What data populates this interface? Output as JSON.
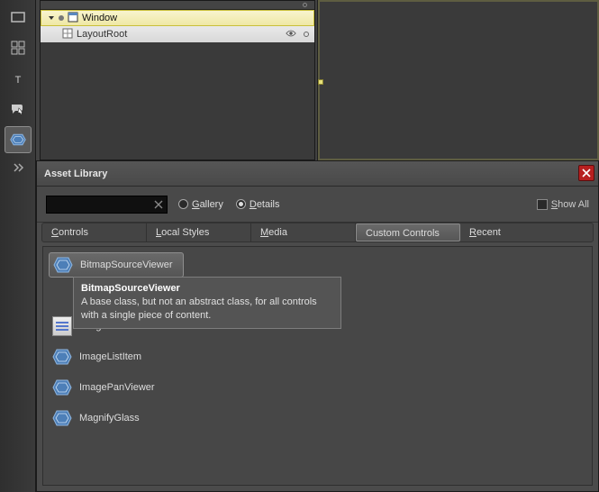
{
  "outline": {
    "window_label": "Window",
    "layout_label": "LayoutRoot"
  },
  "dialog": {
    "title": "Asset Library",
    "search_value": "",
    "view_gallery": "Gallery",
    "view_details": "Details",
    "show_all": "Show All",
    "tabs": {
      "controls": "Controls",
      "local_styles": "Local Styles",
      "media": "Media",
      "custom_controls": "Custom Controls",
      "recent": "Recent"
    },
    "items": {
      "bitmapsourceviewer": "BitmapSourceViewer",
      "imagelist": "ImageList",
      "imagelistitem": "ImageListItem",
      "imagepanviewer": "ImagePanViewer",
      "magnifyglass": "MagnifyGlass"
    },
    "tooltip": {
      "title": "BitmapSourceViewer",
      "body": "A base class, but not an abstract class, for all controls with a single piece of content."
    }
  }
}
